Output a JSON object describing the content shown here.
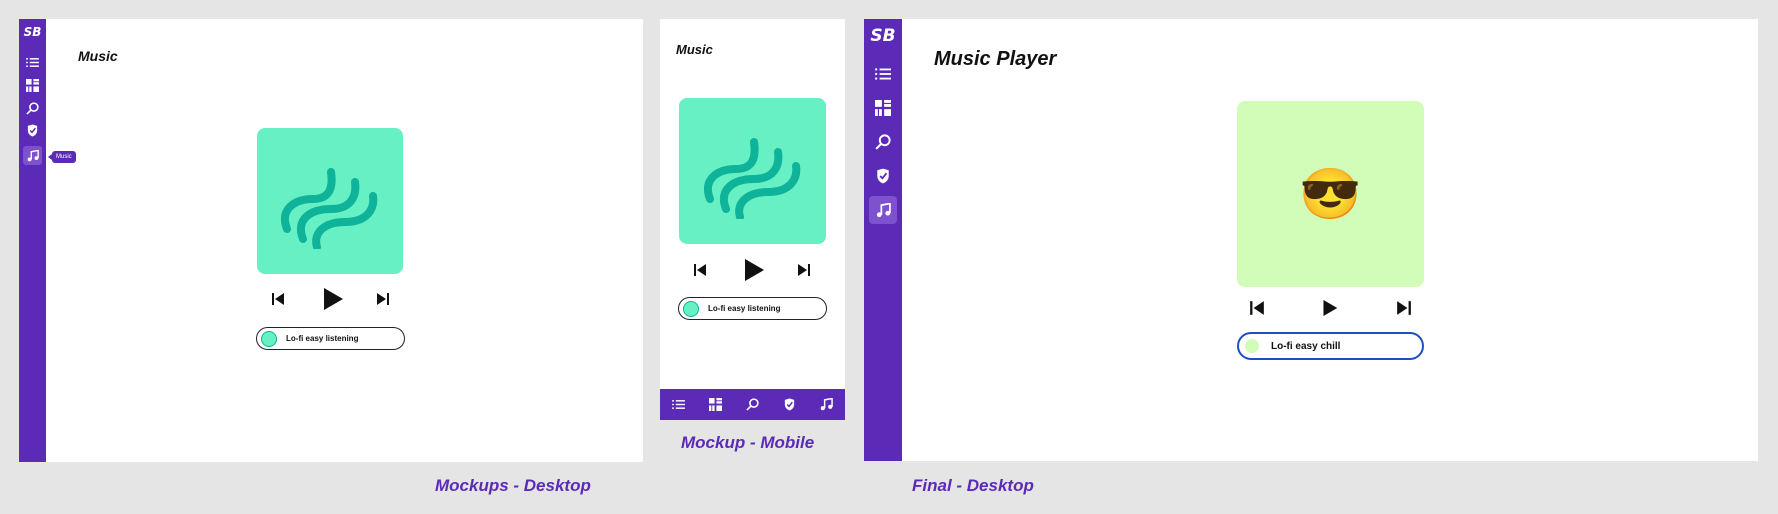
{
  "brand": {
    "logo_text": "SB",
    "accent_color": "#5b2bb8",
    "mockup_art_color": "#66f0c4",
    "final_art_color": "#d2fdb9",
    "final_track_border": "#1e4fbf"
  },
  "nav_icons": [
    "list-icon",
    "dashboard-grid-icon",
    "search-icon",
    "shield-icon",
    "music-note-icon"
  ],
  "desktop_mockup": {
    "title": "Music",
    "tooltip": "Music",
    "track": "Lo-fi easy listening"
  },
  "mobile_mockup": {
    "title": "Music",
    "track": "Lo-fi easy listening"
  },
  "final_desktop": {
    "title": "Music Player",
    "album_emoji": "😎",
    "track": "Lo-fi easy chill"
  },
  "controls": [
    "previous-icon",
    "play-icon",
    "next-icon"
  ],
  "captions": {
    "desktop_mockup": "Mockups - Desktop",
    "mobile_mockup": "Mockup - Mobile",
    "final_desktop": "Final - Desktop"
  }
}
